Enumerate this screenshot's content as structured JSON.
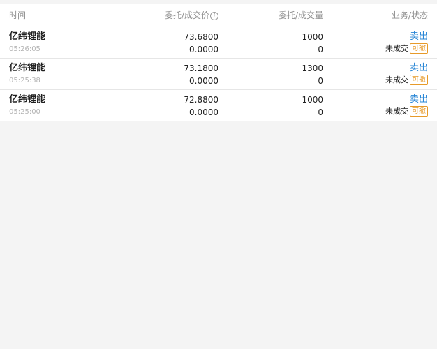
{
  "header": {
    "time": "时间",
    "price": "委托/成交价",
    "qty": "委托/成交量",
    "status": "业务/状态",
    "info_icon": "i"
  },
  "orders": [
    {
      "name": "亿纬锂能",
      "time": "05:26:05",
      "order_price": "73.6800",
      "deal_price": "0.0000",
      "order_qty": "1000",
      "deal_qty": "0",
      "business": "卖出",
      "status": "未成交",
      "action": "可撤"
    },
    {
      "name": "亿纬锂能",
      "time": "05:25:38",
      "order_price": "73.1800",
      "deal_price": "0.0000",
      "order_qty": "1300",
      "deal_qty": "0",
      "business": "卖出",
      "status": "未成交",
      "action": "可撤"
    },
    {
      "name": "亿纬锂能",
      "time": "05:25:00",
      "order_price": "72.8800",
      "deal_price": "0.0000",
      "order_qty": "1000",
      "deal_qty": "0",
      "business": "卖出",
      "status": "未成交",
      "action": "可撤"
    }
  ],
  "colors": {
    "business": "#2a87d6",
    "badge": "#e79a29",
    "background": "#f4f4f4"
  },
  "icons": {
    "info": "info-icon"
  }
}
